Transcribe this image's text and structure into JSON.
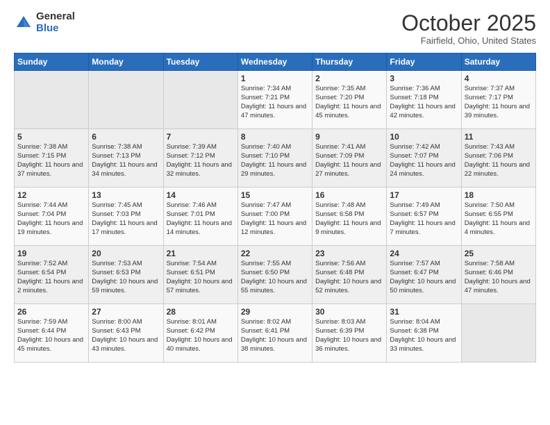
{
  "header": {
    "logo_general": "General",
    "logo_blue": "Blue",
    "month": "October 2025",
    "location": "Fairfield, Ohio, United States"
  },
  "days_of_week": [
    "Sunday",
    "Monday",
    "Tuesday",
    "Wednesday",
    "Thursday",
    "Friday",
    "Saturday"
  ],
  "weeks": [
    [
      {
        "day": "",
        "info": ""
      },
      {
        "day": "",
        "info": ""
      },
      {
        "day": "",
        "info": ""
      },
      {
        "day": "1",
        "info": "Sunrise: 7:34 AM\nSunset: 7:21 PM\nDaylight: 11 hours and 47 minutes."
      },
      {
        "day": "2",
        "info": "Sunrise: 7:35 AM\nSunset: 7:20 PM\nDaylight: 11 hours and 45 minutes."
      },
      {
        "day": "3",
        "info": "Sunrise: 7:36 AM\nSunset: 7:18 PM\nDaylight: 11 hours and 42 minutes."
      },
      {
        "day": "4",
        "info": "Sunrise: 7:37 AM\nSunset: 7:17 PM\nDaylight: 11 hours and 39 minutes."
      }
    ],
    [
      {
        "day": "5",
        "info": "Sunrise: 7:38 AM\nSunset: 7:15 PM\nDaylight: 11 hours and 37 minutes."
      },
      {
        "day": "6",
        "info": "Sunrise: 7:38 AM\nSunset: 7:13 PM\nDaylight: 11 hours and 34 minutes."
      },
      {
        "day": "7",
        "info": "Sunrise: 7:39 AM\nSunset: 7:12 PM\nDaylight: 11 hours and 32 minutes."
      },
      {
        "day": "8",
        "info": "Sunrise: 7:40 AM\nSunset: 7:10 PM\nDaylight: 11 hours and 29 minutes."
      },
      {
        "day": "9",
        "info": "Sunrise: 7:41 AM\nSunset: 7:09 PM\nDaylight: 11 hours and 27 minutes."
      },
      {
        "day": "10",
        "info": "Sunrise: 7:42 AM\nSunset: 7:07 PM\nDaylight: 11 hours and 24 minutes."
      },
      {
        "day": "11",
        "info": "Sunrise: 7:43 AM\nSunset: 7:06 PM\nDaylight: 11 hours and 22 minutes."
      }
    ],
    [
      {
        "day": "12",
        "info": "Sunrise: 7:44 AM\nSunset: 7:04 PM\nDaylight: 11 hours and 19 minutes."
      },
      {
        "day": "13",
        "info": "Sunrise: 7:45 AM\nSunset: 7:03 PM\nDaylight: 11 hours and 17 minutes."
      },
      {
        "day": "14",
        "info": "Sunrise: 7:46 AM\nSunset: 7:01 PM\nDaylight: 11 hours and 14 minutes."
      },
      {
        "day": "15",
        "info": "Sunrise: 7:47 AM\nSunset: 7:00 PM\nDaylight: 11 hours and 12 minutes."
      },
      {
        "day": "16",
        "info": "Sunrise: 7:48 AM\nSunset: 6:58 PM\nDaylight: 11 hours and 9 minutes."
      },
      {
        "day": "17",
        "info": "Sunrise: 7:49 AM\nSunset: 6:57 PM\nDaylight: 11 hours and 7 minutes."
      },
      {
        "day": "18",
        "info": "Sunrise: 7:50 AM\nSunset: 6:55 PM\nDaylight: 11 hours and 4 minutes."
      }
    ],
    [
      {
        "day": "19",
        "info": "Sunrise: 7:52 AM\nSunset: 6:54 PM\nDaylight: 11 hours and 2 minutes."
      },
      {
        "day": "20",
        "info": "Sunrise: 7:53 AM\nSunset: 6:53 PM\nDaylight: 10 hours and 59 minutes."
      },
      {
        "day": "21",
        "info": "Sunrise: 7:54 AM\nSunset: 6:51 PM\nDaylight: 10 hours and 57 minutes."
      },
      {
        "day": "22",
        "info": "Sunrise: 7:55 AM\nSunset: 6:50 PM\nDaylight: 10 hours and 55 minutes."
      },
      {
        "day": "23",
        "info": "Sunrise: 7:56 AM\nSunset: 6:48 PM\nDaylight: 10 hours and 52 minutes."
      },
      {
        "day": "24",
        "info": "Sunrise: 7:57 AM\nSunset: 6:47 PM\nDaylight: 10 hours and 50 minutes."
      },
      {
        "day": "25",
        "info": "Sunrise: 7:58 AM\nSunset: 6:46 PM\nDaylight: 10 hours and 47 minutes."
      }
    ],
    [
      {
        "day": "26",
        "info": "Sunrise: 7:59 AM\nSunset: 6:44 PM\nDaylight: 10 hours and 45 minutes."
      },
      {
        "day": "27",
        "info": "Sunrise: 8:00 AM\nSunset: 6:43 PM\nDaylight: 10 hours and 43 minutes."
      },
      {
        "day": "28",
        "info": "Sunrise: 8:01 AM\nSunset: 6:42 PM\nDaylight: 10 hours and 40 minutes."
      },
      {
        "day": "29",
        "info": "Sunrise: 8:02 AM\nSunset: 6:41 PM\nDaylight: 10 hours and 38 minutes."
      },
      {
        "day": "30",
        "info": "Sunrise: 8:03 AM\nSunset: 6:39 PM\nDaylight: 10 hours and 36 minutes."
      },
      {
        "day": "31",
        "info": "Sunrise: 8:04 AM\nSunset: 6:38 PM\nDaylight: 10 hours and 33 minutes."
      },
      {
        "day": "",
        "info": ""
      }
    ]
  ]
}
